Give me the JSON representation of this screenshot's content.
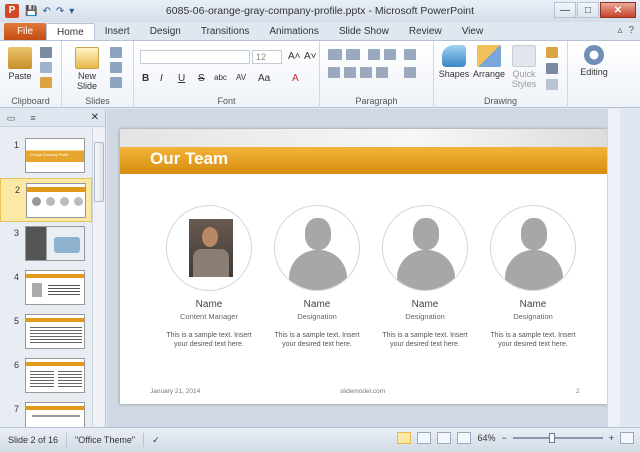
{
  "window": {
    "title": "6085-06-orange-gray-company-profile.pptx - Microsoft PowerPoint",
    "app_icon": "P",
    "minimize": "—",
    "maximize": "□",
    "close": "✕"
  },
  "qat": {
    "save": "💾",
    "undo": "↶",
    "redo": "↷",
    "customize": "▾"
  },
  "tabs": {
    "file": "File",
    "items": [
      "Home",
      "Insert",
      "Design",
      "Transitions",
      "Animations",
      "Slide Show",
      "Review",
      "View"
    ],
    "active_index": 0,
    "minimize_ribbon": "▵",
    "help": "?"
  },
  "ribbon": {
    "clipboard": {
      "label": "Clipboard",
      "paste": "Paste"
    },
    "slides": {
      "label": "Slides",
      "new_slide": "New Slide"
    },
    "font": {
      "label": "Font",
      "font_name": "",
      "font_size": "12",
      "bold": "B",
      "italic": "I",
      "underline": "U",
      "strike": "S",
      "shadow": "abc",
      "spacing": "AV",
      "case": "Aa",
      "grow": "A˄",
      "shrink": "A˅",
      "clear": "A",
      "color": "A"
    },
    "paragraph": {
      "label": "Paragraph"
    },
    "drawing": {
      "label": "Drawing",
      "shapes": "Shapes",
      "arrange": "Arrange",
      "quick_styles": "Quick Styles"
    },
    "editing": {
      "label": "Editing",
      "editing": "Editing"
    }
  },
  "left_panel": {
    "tab_slides": "▭",
    "tab_outline": "≡",
    "close": "✕",
    "slide_numbers": [
      "1",
      "2",
      "3",
      "4",
      "5",
      "6",
      "7"
    ],
    "selected_index": 1,
    "thumb1_title": "Orange Company Profile"
  },
  "slide": {
    "title": "Our Team",
    "members": [
      {
        "name": "Name",
        "role": "Content Manager",
        "desc": "This is a sample text. Insert your desired text here.",
        "photo": true
      },
      {
        "name": "Name",
        "role": "Designation",
        "desc": "This is a sample text. Insert your desired text here.",
        "photo": false
      },
      {
        "name": "Name",
        "role": "Designation",
        "desc": "This is a sample text. Insert your desired text here.",
        "photo": false
      },
      {
        "name": "Name",
        "role": "Designation",
        "desc": "This is a sample text. Insert your desired text here.",
        "photo": false
      }
    ],
    "footer_date": "January 21, 2014",
    "footer_site": "slidemodel.com",
    "footer_page": "2"
  },
  "status": {
    "slide_info": "Slide 2 of 16",
    "theme": "\"Office Theme\"",
    "zoom": "64%",
    "zoom_out": "−",
    "zoom_in": "+"
  },
  "colors": {
    "accent": "#e39a1b",
    "file_tab": "#c84e18",
    "ribbon_bg": "#ffffff"
  }
}
